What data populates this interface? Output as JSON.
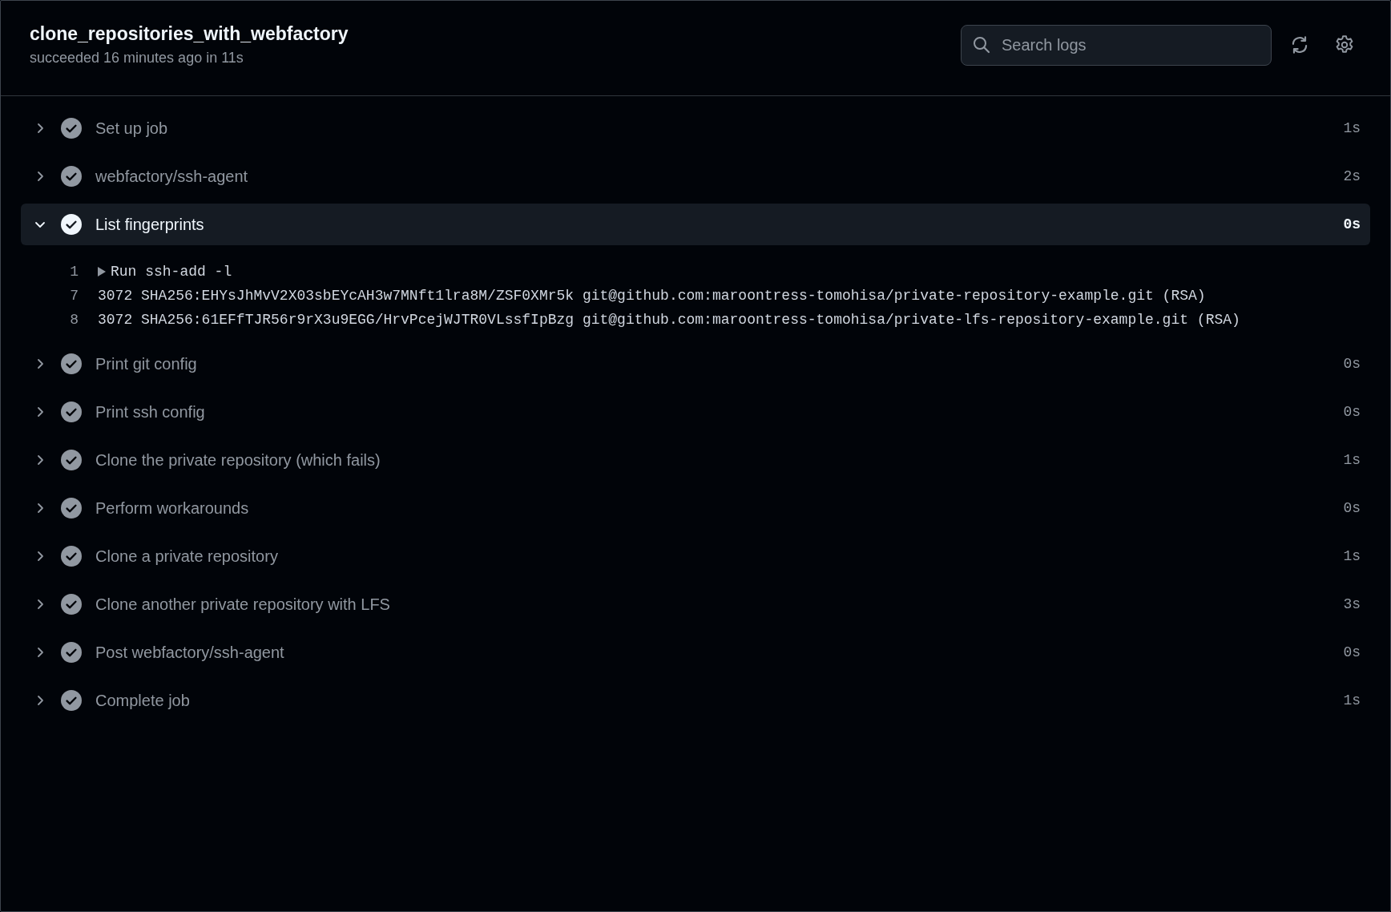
{
  "job": {
    "title": "clone_repositories_with_webfactory",
    "status": "succeeded 16 minutes ago in 11s"
  },
  "search": {
    "placeholder": "Search logs"
  },
  "steps": [
    {
      "name": "Set up job",
      "duration": "1s",
      "expanded": false
    },
    {
      "name": "webfactory/ssh-agent",
      "duration": "2s",
      "expanded": false
    },
    {
      "name": "List fingerprints",
      "duration": "0s",
      "expanded": true,
      "log": [
        {
          "number": "1",
          "text": "Run ssh-add -l",
          "kind": "group"
        },
        {
          "number": "7",
          "text": "3072 SHA256:EHYsJhMvV2X03sbEYcAH3w7MNft1lra8M/ZSF0XMr5k git@github.com:maroontress-tomohisa/private-repository-example.git (RSA)",
          "kind": "line"
        },
        {
          "number": "8",
          "text": "3072 SHA256:61EFfTJR56r9rX3u9EGG/HrvPcejWJTR0VLssfIpBzg git@github.com:maroontress-tomohisa/private-lfs-repository-example.git (RSA)",
          "kind": "line"
        }
      ]
    },
    {
      "name": "Print git config",
      "duration": "0s",
      "expanded": false
    },
    {
      "name": "Print ssh config",
      "duration": "0s",
      "expanded": false
    },
    {
      "name": "Clone the private repository (which fails)",
      "duration": "1s",
      "expanded": false
    },
    {
      "name": "Perform workarounds",
      "duration": "0s",
      "expanded": false
    },
    {
      "name": "Clone a private repository",
      "duration": "1s",
      "expanded": false
    },
    {
      "name": "Clone another private repository with LFS",
      "duration": "3s",
      "expanded": false
    },
    {
      "name": "Post webfactory/ssh-agent",
      "duration": "0s",
      "expanded": false
    },
    {
      "name": "Complete job",
      "duration": "1s",
      "expanded": false
    }
  ]
}
